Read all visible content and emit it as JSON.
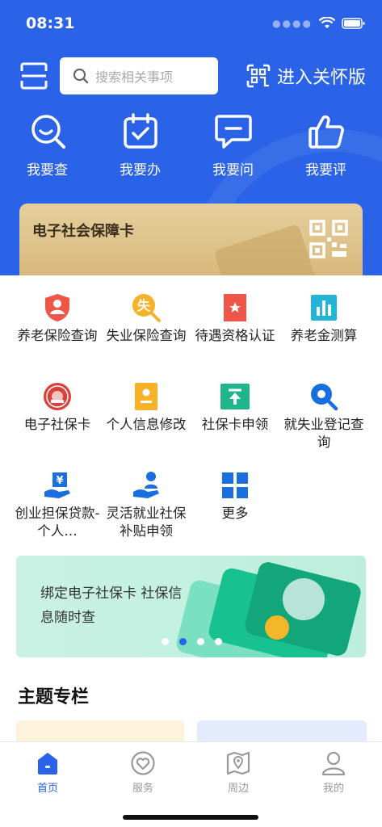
{
  "status": {
    "time": "08:31"
  },
  "header": {
    "search_placeholder": "搜索相关事项",
    "care_label": "进入关怀版"
  },
  "quick_actions": [
    {
      "label": "我要查",
      "icon": "search-smile-icon"
    },
    {
      "label": "我要办",
      "icon": "calendar-check-icon"
    },
    {
      "label": "我要问",
      "icon": "chat-bubble-icon"
    },
    {
      "label": "我要评",
      "icon": "thumbs-up-icon"
    }
  ],
  "card": {
    "title": "电子社会保障卡",
    "icon": "qr-code-icon"
  },
  "services": [
    {
      "label": "养老保险查询",
      "icon": "shield-person-icon",
      "color": "#f0554a"
    },
    {
      "label": "失业保险查询",
      "icon": "unemployment-search-icon",
      "color": "#f7b22a",
      "glyph": "失"
    },
    {
      "label": "待遇资格认证",
      "icon": "bookmark-star-icon",
      "color": "#f0554a"
    },
    {
      "label": "养老金测算",
      "icon": "bar-chart-icon",
      "color": "#22b5d8"
    },
    {
      "label": "电子社保卡",
      "icon": "emblem-icon",
      "color": "#d9413a"
    },
    {
      "label": "个人信息修改",
      "icon": "person-card-icon",
      "color": "#f7b22a"
    },
    {
      "label": "社保卡申领",
      "icon": "card-upload-icon",
      "color": "#1fb58a"
    },
    {
      "label": "就失业登记查询",
      "icon": "search-icon",
      "color": "#1a6fe0"
    },
    {
      "label": "创业担保贷款-个人…",
      "icon": "loan-hand-icon",
      "color": "#1a6fe0",
      "glyph": "¥"
    },
    {
      "label": "灵活就业社保补贴申领",
      "icon": "hand-person-icon",
      "color": "#1a6fe0"
    },
    {
      "label": "更多",
      "icon": "grid-more-icon",
      "color": "#1a6fe0"
    }
  ],
  "banner": {
    "text": "绑定电子社保卡 社保信息随时查"
  },
  "section": {
    "title": "主题专栏"
  },
  "tabs": [
    {
      "label": "首页",
      "icon": "home-icon"
    },
    {
      "label": "服务",
      "icon": "heart-service-icon"
    },
    {
      "label": "周边",
      "icon": "map-pin-icon"
    },
    {
      "label": "我的",
      "icon": "user-icon"
    }
  ],
  "colors": {
    "primary": "#2a63e8",
    "card_gold": "#d7b77a",
    "banner_green": "#c9f1e4"
  }
}
